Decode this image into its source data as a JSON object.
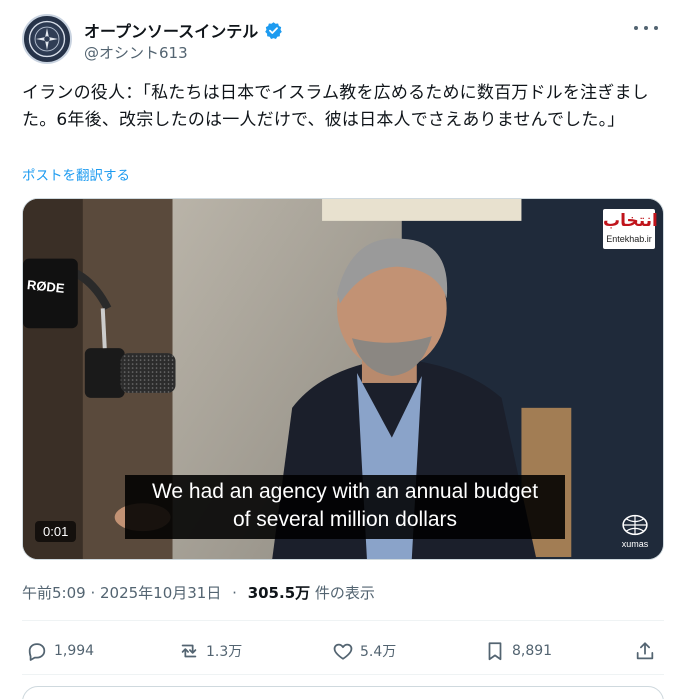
{
  "author": {
    "display_name": "オープンソースインテル",
    "handle": "@オシント613",
    "verified": true,
    "avatar_icon": "avatar-image"
  },
  "post": {
    "text": "イランの役人：「私たちは日本でイスラム教を広めるために数百万ドルを注ぎました。6年後、改宗したのは一人だけで、彼は日本人でさえありませんでした。」",
    "translate_label": "ポストを翻訳する"
  },
  "video": {
    "subtitle_line1": "We had an agency with an annual budget",
    "subtitle_line2": "of several million dollars",
    "elapsed": "0:01",
    "watermark_top": "انتخاب",
    "watermark_top_sub": "Entekhab.ir",
    "watermark_bottom": "xumas",
    "mic_brand": "RØDE"
  },
  "meta": {
    "timestamp": "午前5:09 · 2025年10月31日",
    "separator": "·",
    "views_count": "305.5万",
    "views_label": "件の表示"
  },
  "actions": {
    "replies": "1,994",
    "reposts": "1.3万",
    "likes": "5.4万",
    "bookmarks": "8,891"
  },
  "colors": {
    "accent": "#1d9bf0",
    "text_primary": "#0f1419",
    "text_secondary": "#536471"
  }
}
